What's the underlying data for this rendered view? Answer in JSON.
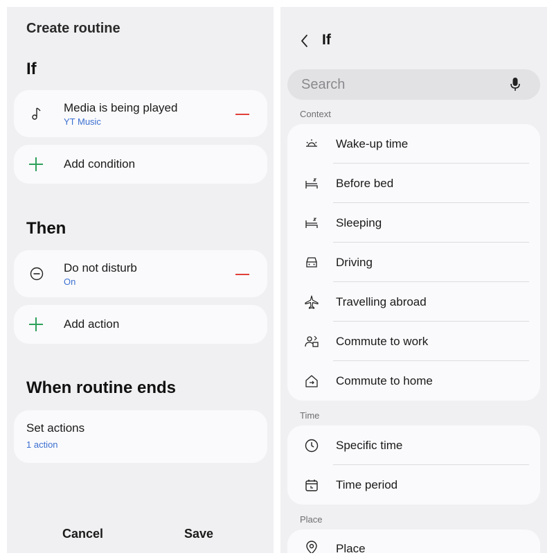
{
  "left": {
    "title": "Create routine",
    "if_heading": "If",
    "condition": {
      "title": "Media is being played",
      "subtitle": "YT Music",
      "icon": "music-note-icon"
    },
    "add_condition": "Add condition",
    "then_heading": "Then",
    "action": {
      "title": "Do not disturb",
      "subtitle": "On",
      "icon": "do-not-disturb-icon"
    },
    "add_action": "Add action",
    "ends_heading": "When routine ends",
    "set_actions": {
      "title": "Set actions",
      "subtitle": "1 action"
    },
    "cancel": "Cancel",
    "save": "Save"
  },
  "right": {
    "title": "If",
    "search_placeholder": "Search",
    "context_label": "Context",
    "context_items": [
      {
        "label": "Wake-up time",
        "icon": "sunrise-icon"
      },
      {
        "label": "Before bed",
        "icon": "bed-icon"
      },
      {
        "label": "Sleeping",
        "icon": "bed-icon"
      },
      {
        "label": "Driving",
        "icon": "car-icon"
      },
      {
        "label": "Travelling abroad",
        "icon": "airplane-icon"
      },
      {
        "label": "Commute to work",
        "icon": "commute-work-icon"
      },
      {
        "label": "Commute to home",
        "icon": "commute-home-icon"
      }
    ],
    "time_label": "Time",
    "time_items": [
      {
        "label": "Specific time",
        "icon": "clock-icon"
      },
      {
        "label": "Time period",
        "icon": "calendar-icon"
      }
    ],
    "place_label": "Place",
    "place_items": [
      {
        "label": "Place",
        "icon": "location-pin-icon"
      }
    ]
  },
  "colors": {
    "accent_blue": "#3b6fd0",
    "remove_red": "#e0403a",
    "add_green": "#2ea05a",
    "panel_bg": "#f0f0f2"
  }
}
